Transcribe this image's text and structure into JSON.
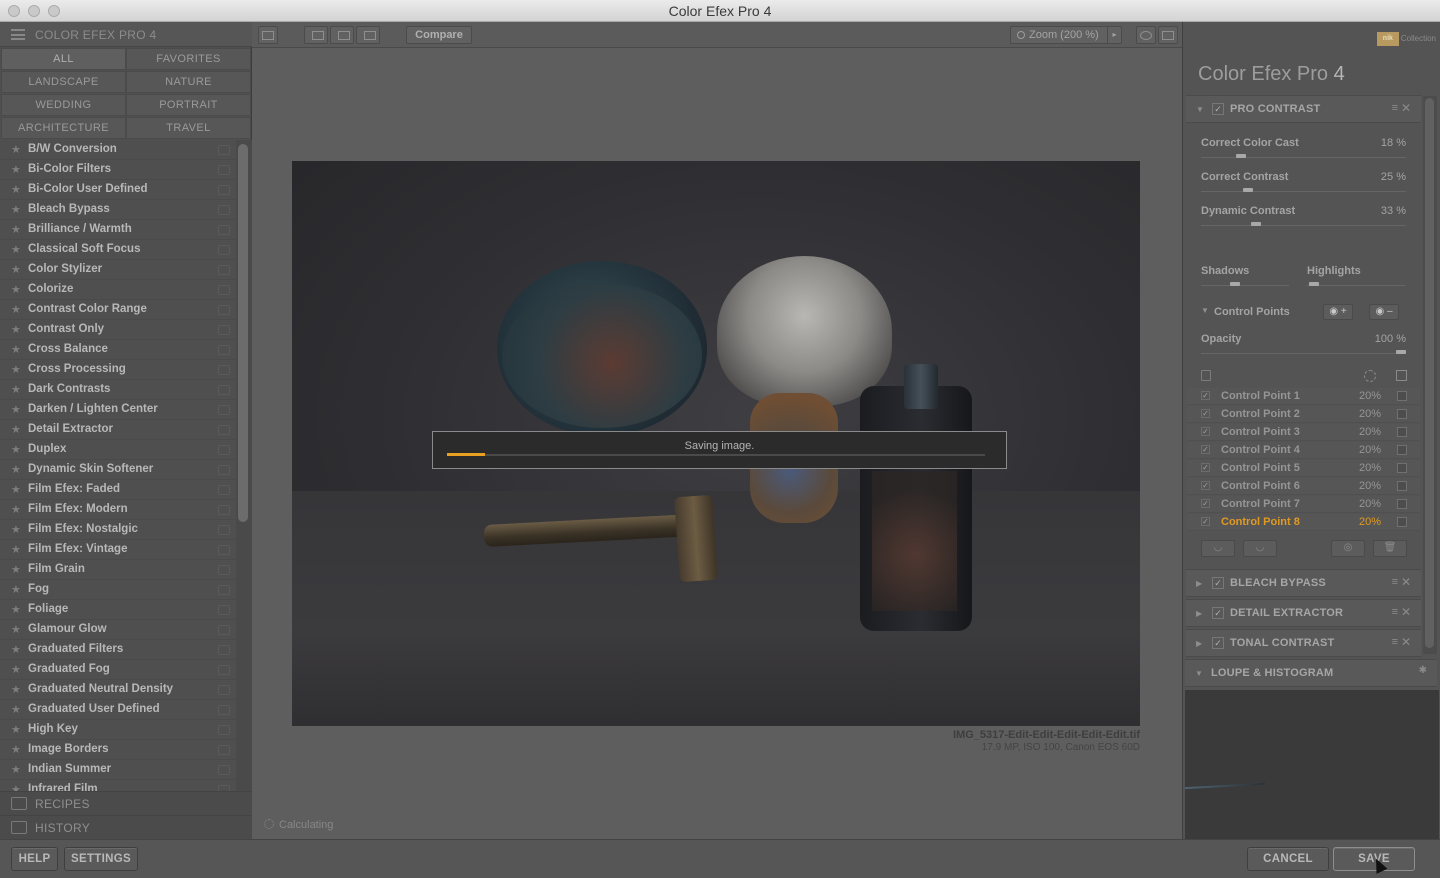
{
  "window": {
    "title": "Color Efex Pro 4"
  },
  "left_panel": {
    "header": "COLOR EFEX PRO 4",
    "categories": [
      "ALL",
      "FAVORITES",
      "LANDSCAPE",
      "NATURE",
      "WEDDING",
      "PORTRAIT",
      "ARCHITECTURE",
      "TRAVEL"
    ],
    "filters": [
      "B/W Conversion",
      "Bi-Color Filters",
      "Bi-Color User Defined",
      "Bleach Bypass",
      "Brilliance / Warmth",
      "Classical Soft Focus",
      "Color Stylizer",
      "Colorize",
      "Contrast Color Range",
      "Contrast Only",
      "Cross Balance",
      "Cross Processing",
      "Dark Contrasts",
      "Darken / Lighten Center",
      "Detail Extractor",
      "Duplex",
      "Dynamic Skin Softener",
      "Film Efex: Faded",
      "Film Efex: Modern",
      "Film Efex: Nostalgic",
      "Film Efex: Vintage",
      "Film Grain",
      "Fog",
      "Foliage",
      "Glamour Glow",
      "Graduated Filters",
      "Graduated Fog",
      "Graduated Neutral Density",
      "Graduated User Defined",
      "High Key",
      "Image Borders",
      "Indian Summer",
      "Infrared Film"
    ],
    "recipes": "RECIPES",
    "history": "HISTORY"
  },
  "toolbar": {
    "compare": "Compare",
    "zoom": "Zoom (200 %)"
  },
  "canvas": {
    "saving_message": "Saving image.",
    "saving_progress": 0.07,
    "file_name": "IMG_5317-Edit-Edit-Edit-Edit-Edit.tif",
    "file_meta": "17.9 MP, ISO 100, Canon EOS 60D",
    "status": "Calculating"
  },
  "right_panel": {
    "brand": "Collection",
    "brand_box": "nik",
    "title": "Color Efex Pro",
    "title_version": "4",
    "pro_contrast": {
      "label": "PRO CONTRAST",
      "params": [
        {
          "label": "Correct Color Cast",
          "value": "18 %",
          "level": 0.18
        },
        {
          "label": "Correct Contrast",
          "value": "25 %",
          "level": 0.25
        },
        {
          "label": "Dynamic Contrast",
          "value": "33 %",
          "level": 0.33
        }
      ],
      "shadows": "Shadows",
      "highlights": "Highlights",
      "control_points": "Control Points",
      "opacity": {
        "label": "Opacity",
        "value": "100 %",
        "level": 1.0
      },
      "points": [
        {
          "name": "Control Point 1",
          "value": "20%"
        },
        {
          "name": "Control Point 2",
          "value": "20%"
        },
        {
          "name": "Control Point 3",
          "value": "20%"
        },
        {
          "name": "Control Point 4",
          "value": "20%"
        },
        {
          "name": "Control Point 5",
          "value": "20%"
        },
        {
          "name": "Control Point 6",
          "value": "20%"
        },
        {
          "name": "Control Point 7",
          "value": "20%"
        },
        {
          "name": "Control Point 8",
          "value": "20%"
        }
      ]
    },
    "filters_stack": [
      "BLEACH BYPASS",
      "DETAIL EXTRACTOR",
      "TONAL CONTRAST"
    ],
    "loupe": "LOUPE & HISTOGRAM"
  },
  "bottom": {
    "help": "HELP",
    "settings": "SETTINGS",
    "cancel": "CANCEL",
    "save": "SAVE"
  },
  "colors": {
    "accent": "#e09a22",
    "progress": "#e8a021"
  }
}
